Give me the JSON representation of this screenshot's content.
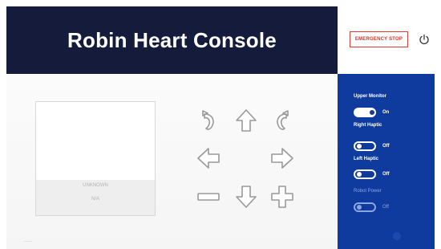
{
  "header": {
    "title": "Robin Heart Console"
  },
  "controls": {
    "emergency_stop": "EMERGENCY STOP",
    "power_icon": "power-icon"
  },
  "preview": {
    "line1": "UNKNOWN",
    "line2": "N/A"
  },
  "arrows": [
    {
      "name": "rotate-left",
      "icon": "rotate-ccw-arrow-icon"
    },
    {
      "name": "up",
      "icon": "arrow-up-icon"
    },
    {
      "name": "rotate-right",
      "icon": "rotate-cw-arrow-icon"
    },
    {
      "name": "left",
      "icon": "arrow-left-icon"
    },
    {
      "name": "right",
      "icon": "arrow-right-icon"
    },
    {
      "name": "zoom-out",
      "icon": "minus-icon"
    },
    {
      "name": "down",
      "icon": "arrow-down-icon"
    },
    {
      "name": "zoom-in",
      "icon": "plus-icon"
    }
  ],
  "panel": {
    "items": [
      {
        "label": "Upper Monitor",
        "state": "On",
        "on": true,
        "dim": false
      },
      {
        "label": "Right Haptic",
        "state": "Off",
        "on": false,
        "dim": false
      },
      {
        "label": "Left Haptic",
        "state": "Off",
        "on": false,
        "dim": false
      },
      {
        "label": "Robot Power",
        "state": "Off",
        "on": false,
        "dim": true
      }
    ]
  },
  "colors": {
    "header_bg": "#151b3b",
    "panel_bg": "#0e3b9d",
    "estop_red": "#d93126"
  }
}
